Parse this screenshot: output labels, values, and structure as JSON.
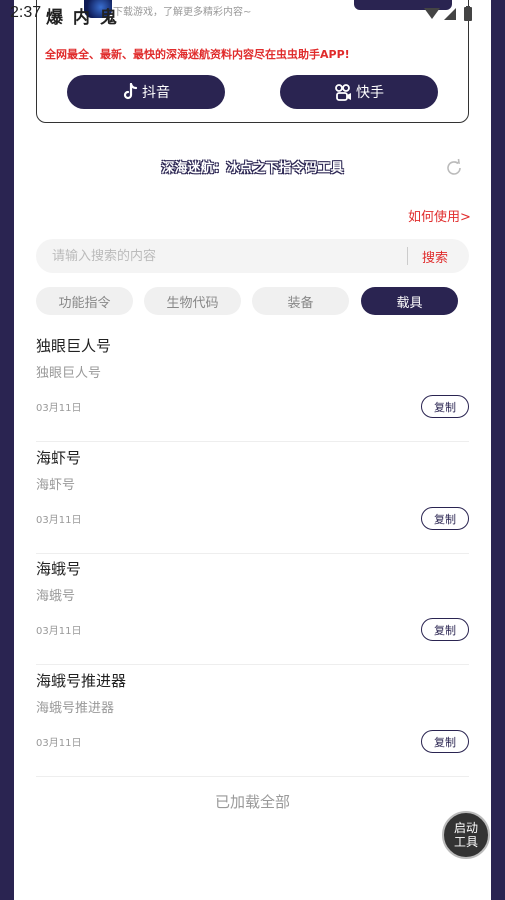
{
  "status_bar": {
    "time": "2:37",
    "app_label": "爆 内 鬼"
  },
  "promo": {
    "subtitle": "下载游戏，了解更多精彩内容~",
    "text": "全网最全、最新、最快的深海迷航资料内容尽在虫虫助手APP!",
    "douyin_label": "抖音",
    "kuaishou_label": "快手"
  },
  "header": {
    "title": "深海迷航：冰点之下指令码工具",
    "howto_label": "如何使用>"
  },
  "search": {
    "placeholder": "请输入搜索的内容",
    "button_label": "搜索"
  },
  "tabs": [
    {
      "label": "功能指令",
      "active": false
    },
    {
      "label": "生物代码",
      "active": false
    },
    {
      "label": "装备",
      "active": false
    },
    {
      "label": "载具",
      "active": true
    }
  ],
  "items": [
    {
      "title": "独眼巨人号",
      "subtitle": "独眼巨人号",
      "date": "03月11日",
      "copy_label": "复制"
    },
    {
      "title": "海虾号",
      "subtitle": "海虾号",
      "date": "03月11日",
      "copy_label": "复制"
    },
    {
      "title": "海蛾号",
      "subtitle": "海蛾号",
      "date": "03月11日",
      "copy_label": "复制"
    },
    {
      "title": "海蛾号推进器",
      "subtitle": "海蛾号推进器",
      "date": "03月11日",
      "copy_label": "复制"
    }
  ],
  "footer": {
    "loaded_text": "已加载全部"
  },
  "fab": {
    "label": "启动工具"
  },
  "colors": {
    "primary": "#2a2451",
    "accent": "#e02c2c",
    "muted": "#999999"
  }
}
